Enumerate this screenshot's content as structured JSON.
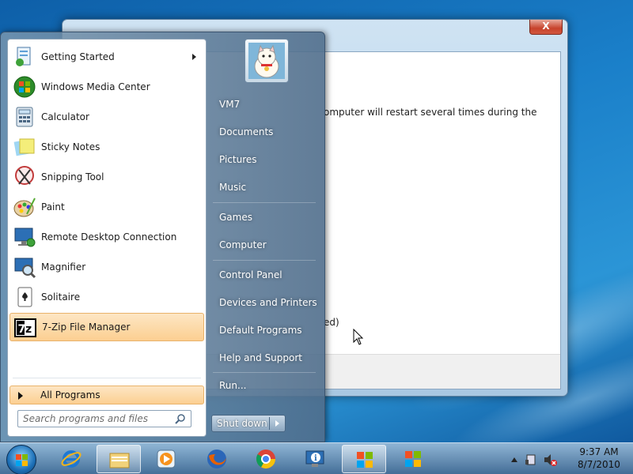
{
  "background_window": {
    "text_line1": "omputer will restart several times during the",
    "text_line2": "ed)",
    "close_label": "X"
  },
  "start_menu": {
    "programs": [
      {
        "label": "Getting Started",
        "icon": "getting-started-icon",
        "submenu": true
      },
      {
        "label": "Windows Media Center",
        "icon": "media-center-icon"
      },
      {
        "label": "Calculator",
        "icon": "calculator-icon"
      },
      {
        "label": "Sticky Notes",
        "icon": "sticky-notes-icon"
      },
      {
        "label": "Snipping Tool",
        "icon": "snipping-tool-icon"
      },
      {
        "label": "Paint",
        "icon": "paint-icon"
      },
      {
        "label": "Remote Desktop Connection",
        "icon": "remote-desktop-icon"
      },
      {
        "label": "Magnifier",
        "icon": "magnifier-icon"
      },
      {
        "label": "Solitaire",
        "icon": "solitaire-icon"
      },
      {
        "label": "7-Zip File Manager",
        "icon": "seven-zip-icon",
        "highlighted": true
      }
    ],
    "all_programs": "All Programs",
    "search_placeholder": "Search programs and files",
    "right_items": [
      "VM7",
      "Documents",
      "Pictures",
      "Music",
      "Games",
      "Computer",
      "Control Panel",
      "Devices and Printers",
      "Default Programs",
      "Help and Support",
      "Run..."
    ],
    "shutdown_label": "Shut down"
  },
  "taskbar": {
    "apps": [
      {
        "name": "internet-explorer",
        "active": false
      },
      {
        "name": "windows-explorer",
        "active": true
      },
      {
        "name": "media-player",
        "active": false
      },
      {
        "name": "firefox",
        "active": false
      },
      {
        "name": "chrome",
        "active": false
      },
      {
        "name": "info-app",
        "active": false
      },
      {
        "name": "windows-setup-1",
        "active": true
      },
      {
        "name": "windows-setup-2",
        "active": false
      }
    ],
    "clock": {
      "time": "9:37 AM",
      "date": "8/7/2010"
    }
  }
}
